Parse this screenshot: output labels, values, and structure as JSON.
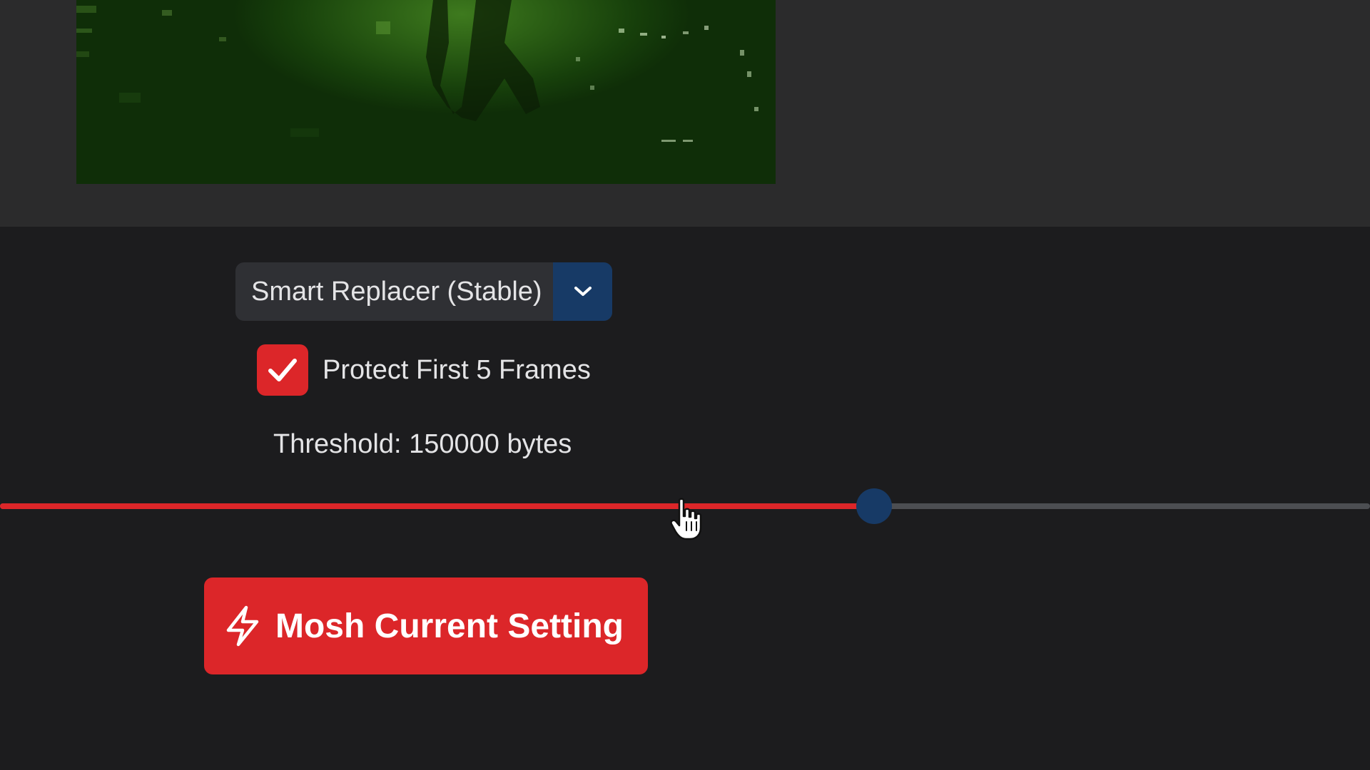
{
  "video_preview": {
    "description_icon": "video-frame"
  },
  "mode_select": {
    "selected_value": "Smart Replacer (Stable)",
    "caret_icon": "chevron-down-icon"
  },
  "protect_frames": {
    "checked": true,
    "label": "Protect First 5 Frames",
    "check_icon": "checkmark-icon"
  },
  "threshold": {
    "label": "Threshold: 150000 bytes",
    "slider_fraction": 0.638
  },
  "mosh_button": {
    "label": "Mosh Current Setting",
    "icon": "lightning-icon"
  },
  "colors": {
    "accent_red": "#dc2629",
    "accent_blue": "#173a66",
    "panel_dark": "#1c1c1e",
    "preview_bg": "#2b2b2c"
  }
}
